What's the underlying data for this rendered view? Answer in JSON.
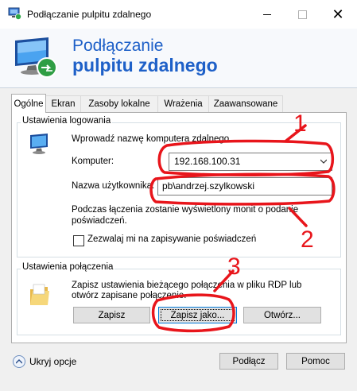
{
  "window": {
    "title": "Podłączanie pulpitu zdalnego",
    "close_glyph": "✕",
    "icons": [
      "remote-desktop-icon",
      "minimize-icon",
      "maximize-icon",
      "close-icon"
    ]
  },
  "banner": {
    "line1": "Podłączanie",
    "line2": "pulpitu zdalnego",
    "accent_color": "#1e60c8"
  },
  "tabs": [
    {
      "label": "Ogólne",
      "active": true
    },
    {
      "label": "Ekran",
      "active": false
    },
    {
      "label": "Zasoby lokalne",
      "active": false
    },
    {
      "label": "Wrażenia",
      "active": false
    },
    {
      "label": "Zaawansowane",
      "active": false
    }
  ],
  "login_settings": {
    "group_label": "Ustawienia logowania",
    "prompt": "Wprowadź nazwę komputera zdalnego.",
    "computer_label": "Komputer:",
    "computer_value": "192.168.100.31",
    "username_label": "Nazwa użytkownika:",
    "username_value": "pb\\andrzej.szylkowski",
    "note_line1": "Podczas łączenia zostanie wyświetlony monit o podanie",
    "note_line2": "poświadczeń.",
    "save_credentials_label": "Zezwalaj mi na zapisywanie poświadczeń",
    "save_credentials_checked": false
  },
  "connection_settings": {
    "group_label": "Ustawienia połączenia",
    "desc_line1": "Zapisz ustawienia bieżącego połączenia w pliku RDP lub",
    "desc_line2": "otwórz zapisane połączenie.",
    "save_button": "Zapisz",
    "save_as_button": "Zapisz jako...",
    "open_button": "Otwórz..."
  },
  "footer": {
    "hide_options": "Ukryj opcje",
    "connect_button": "Podłącz",
    "help_button": "Pomoc"
  },
  "annotations": {
    "color": "#e8151b",
    "labels": [
      "1",
      "2",
      "3"
    ]
  }
}
